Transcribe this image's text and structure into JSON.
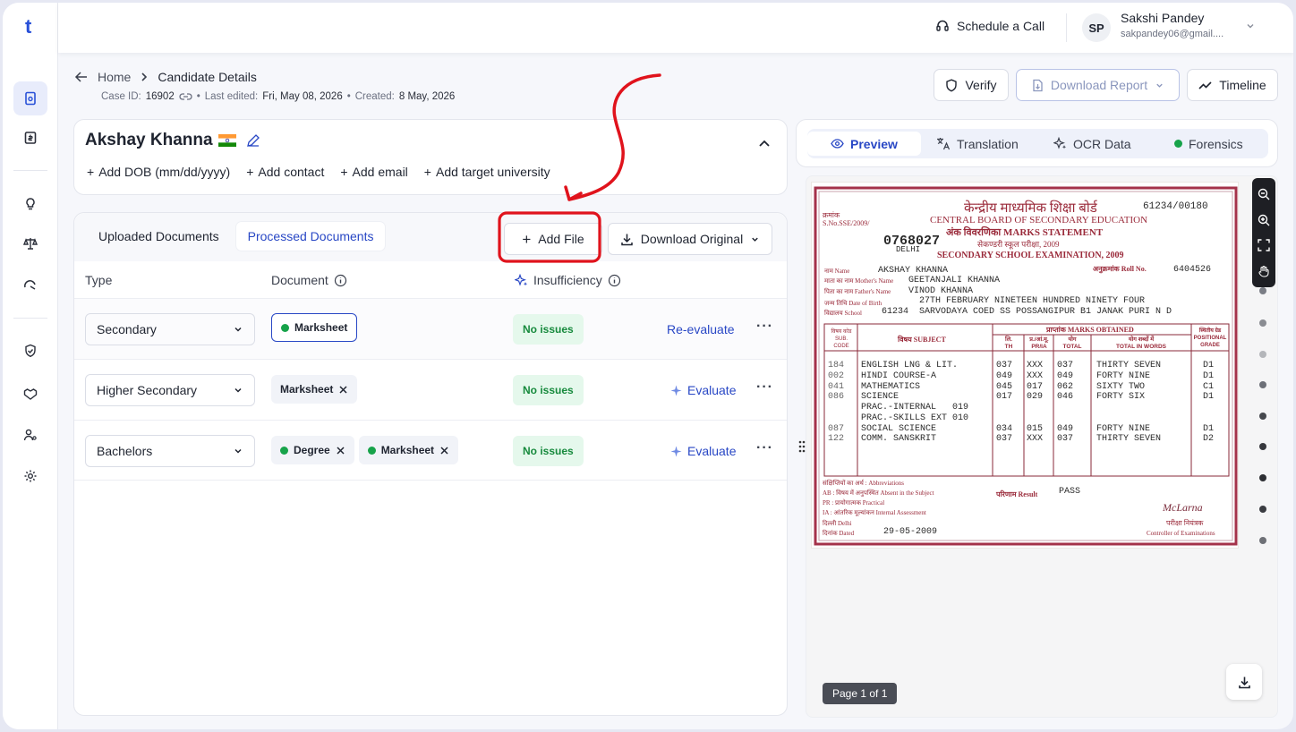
{
  "app": {
    "logo": "t"
  },
  "topbar": {
    "schedule_call": "Schedule a Call",
    "user_initials": "SP",
    "user_name": "Sakshi Pandey",
    "user_email": "sakpandey06@gmail...."
  },
  "breadcrumb": {
    "home": "Home",
    "current": "Candidate Details"
  },
  "case": {
    "id_label": "Case ID:",
    "id": "16902",
    "edited_label": "Last edited:",
    "edited": "Fri, May 08, 2026",
    "created_label": "Created:",
    "created": "8 May, 2026"
  },
  "header_actions": {
    "verify": "Verify",
    "download_report": "Download Report",
    "timeline": "Timeline"
  },
  "candidate": {
    "name": "Akshay Khanna",
    "flag": "🇮🇳",
    "add_dob": "Add DOB (mm/dd/yyyy)",
    "add_contact": "Add contact",
    "add_email": "Add email",
    "add_target_university": "Add target university"
  },
  "docs": {
    "tab_uploaded": "Uploaded Documents",
    "tab_processed": "Processed Documents",
    "add_file": "Add File",
    "download_original": "Download Original",
    "col_type": "Type",
    "col_document": "Document",
    "col_insufficiency": "Insufficiency",
    "rows": [
      {
        "type": "Secondary",
        "chips": [
          "Marksheet"
        ],
        "status": "No issues",
        "action": "Re-evaluate"
      },
      {
        "type": "Higher Secondary",
        "chips": [
          "Marksheet"
        ],
        "status": "No issues",
        "action": "Evaluate"
      },
      {
        "type": "Bachelors",
        "chips": [
          "Degree",
          "Marksheet"
        ],
        "status": "No issues",
        "action": "Evaluate"
      }
    ]
  },
  "preview": {
    "tabs": [
      "Preview",
      "Translation",
      "OCR Data",
      "Forensics"
    ],
    "page_indicator": "Page 1 of 1"
  },
  "marksheet": {
    "board_hindi": "केन्द्रीय माध्यमिक शिक्षा बोर्ड",
    "board_en": "CENTRAL BOARD OF SECONDARY EDUCATION",
    "title_hindi": "अंक विवरणिका MARKS STATEMENT",
    "exam_hindi": "सेकण्डरी स्कूल परीक्षा, 2009",
    "exam_en": "SECONDARY SCHOOL EXAMINATION, 2009",
    "serial_label": "क्रमांक",
    "serial_prefix": "S.No.SSE/2009/",
    "serial_no": "0768027",
    "city": "DELHI",
    "ref_no": "61234/00180",
    "roll_label": "अनुक्रमांक Roll No.",
    "roll_no": "6404526",
    "name_label": "नाम Name",
    "name": "AKSHAY KHANNA",
    "mother_label": "माता का नाम Mother's Name",
    "mother": "GEETANJALI KHANNA",
    "father_label": "पिता का नाम Father's Name",
    "father": "VINOD KHANNA",
    "dob_label": "जन्म तिथि Date of Birth",
    "dob": "27TH FEBRUARY NINETEEN HUNDRED NINETY FOUR",
    "school_label": "विद्यालय School",
    "school_code": "61234",
    "school": "SARVODAYA COED SS POSSANGIPUR B1 JANAK PURI N D",
    "h_code": [
      "विषय कोड",
      "SUB.",
      "CODE"
    ],
    "h_subject": "विषय SUBJECT",
    "h_obtained": "प्राप्तांक MARKS OBTAINED",
    "h_th": [
      "लि.",
      "TH"
    ],
    "h_pr": [
      "प्र./आं.मू.",
      "PR/IA"
    ],
    "h_total": [
      "योग",
      "TOTAL"
    ],
    "h_words": [
      "योग शब्दों में",
      "TOTAL IN WORDS"
    ],
    "h_grade": [
      "स्थितीय ग्रेड",
      "POSITIONAL",
      "GRADE"
    ],
    "subjects": [
      {
        "code": "184",
        "name": "ENGLISH LNG & LIT.",
        "th": "037",
        "pr": "XXX",
        "total": "037",
        "words": "THIRTY SEVEN",
        "grade": "D1"
      },
      {
        "code": "002",
        "name": "HINDI COURSE-A",
        "th": "049",
        "pr": "XXX",
        "total": "049",
        "words": "FORTY NINE",
        "grade": "D1"
      },
      {
        "code": "041",
        "name": "MATHEMATICS",
        "th": "045",
        "pr": "017",
        "total": "062",
        "words": "SIXTY TWO",
        "grade": "C1"
      },
      {
        "code": "086",
        "name": "SCIENCE",
        "th": "017",
        "pr": "029",
        "total": "046",
        "words": "FORTY SIX",
        "grade": "D1"
      },
      {
        "code": "",
        "name": "PRAC.-INTERNAL   019",
        "th": "",
        "pr": "",
        "total": "",
        "words": "",
        "grade": ""
      },
      {
        "code": "",
        "name": "PRAC.-SKILLS EXT 010",
        "th": "",
        "pr": "",
        "total": "",
        "words": "",
        "grade": ""
      },
      {
        "code": "087",
        "name": "SOCIAL SCIENCE",
        "th": "034",
        "pr": "015",
        "total": "049",
        "words": "FORTY NINE",
        "grade": "D1"
      },
      {
        "code": "122",
        "name": "COMM. SANSKRIT",
        "th": "037",
        "pr": "XXX",
        "total": "037",
        "words": "THIRTY SEVEN",
        "grade": "D2"
      }
    ],
    "abbr_title": "संक्षिप्तियों का अर्थ : Abbreviations",
    "abbr_ab": "AB : विषय में अनुपस्थित Absent in the Subject",
    "abbr_pr": "PR : प्रायोगात्मक Practical",
    "abbr_ia": "IA : आंतरिक मूल्यांकन Internal Assessment",
    "result_label": "परिणाम Result",
    "result": "PASS",
    "place": "दिल्ली Delhi",
    "dated_label": "दिनांक Dated",
    "dated": "29-05-2009",
    "signature": "McLarna",
    "controller_hindi": "परीक्षा नियंत्रक",
    "controller": "Controller of Examinations"
  },
  "colors": {
    "accent": "#2847c5",
    "annotation": "#e0131c",
    "success_bg": "#e5f8ec",
    "success_text": "#178a3d",
    "doc_red": "#9a2a3a"
  }
}
